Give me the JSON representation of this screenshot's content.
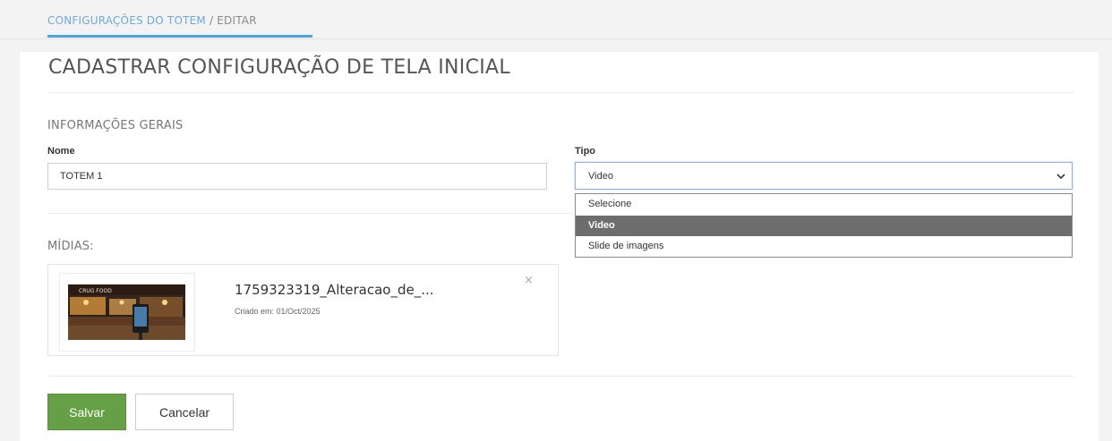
{
  "breadcrumb": {
    "parent": "CONFIGURAÇÕES DO TOTEM",
    "separator": " / ",
    "current": "EDITAR"
  },
  "page": {
    "title": "CADASTRAR CONFIGURAÇÃO DE TELA INICIAL"
  },
  "general_info": {
    "section_title": "INFORMAÇÕES GERAIS",
    "name_label": "Nome",
    "name_value": "TOTEM 1",
    "type_label": "Tipo",
    "type_selected": "Video",
    "type_options": [
      "Selecione",
      "Video",
      "Slide de imagens"
    ],
    "chevron_icon": "chevron-down-icon"
  },
  "media": {
    "section_title": "MÍDIAS:",
    "items": [
      {
        "name": "1759323319_Alteracao_de_...",
        "created": "Criado em: 01/Oct/2025",
        "thumbnail_text": "CRUG FOOD",
        "remove_icon": "close-icon",
        "remove_symbol": "×"
      }
    ]
  },
  "actions": {
    "save_label": "Salvar",
    "cancel_label": "Cancelar"
  },
  "colors": {
    "accent_blue": "#4aa3df",
    "link_blue": "#6ea9d8",
    "save_green": "#66a046",
    "selected_option": "#6d6d6d"
  }
}
